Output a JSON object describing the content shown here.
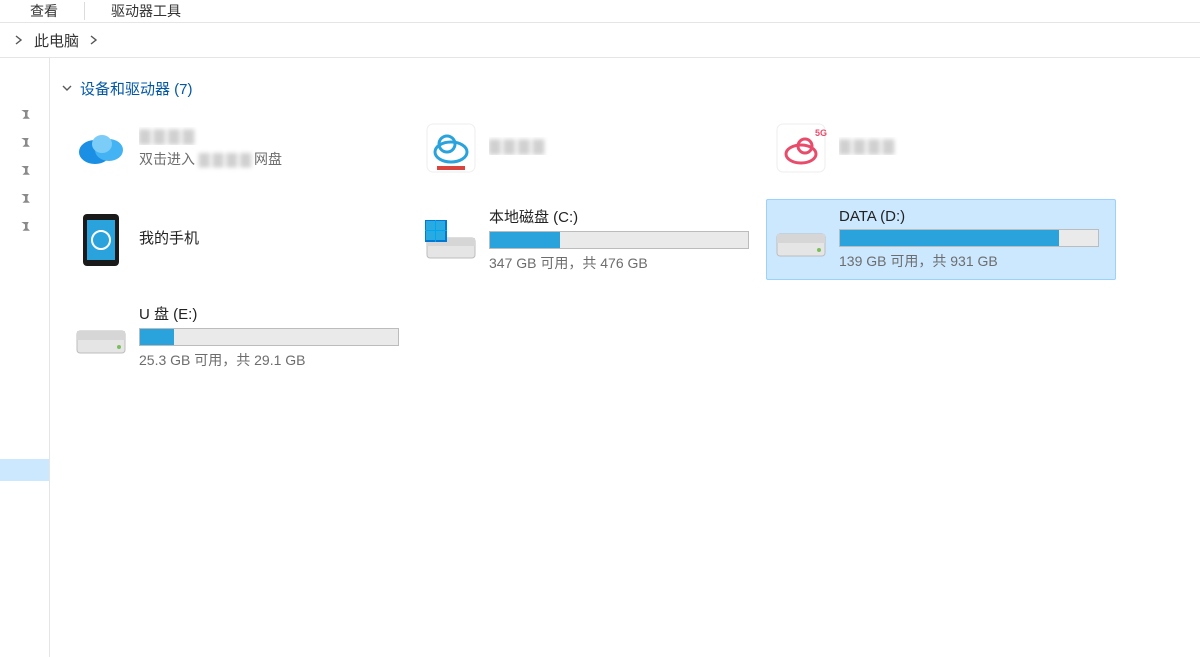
{
  "tabs": {
    "view": "查看",
    "drive_tools": "驱动器工具"
  },
  "breadcrumb": {
    "root": "此电脑"
  },
  "group": {
    "title": "设备和驱动器",
    "count": 7,
    "label_full": "设备和驱动器 (7)"
  },
  "obscured": "▇▇▇▇",
  "items": [
    {
      "kind": "cloud-blue",
      "title": "",
      "sub_prefix": "双击进入",
      "sub_suffix_obscured": true,
      "sub_suffix": "网盘"
    },
    {
      "kind": "cloud-white",
      "title": "",
      "sub": ""
    },
    {
      "kind": "cloud-red",
      "title": "",
      "sub": ""
    },
    {
      "kind": "phone",
      "title": "我的手机",
      "sub": ""
    },
    {
      "kind": "drive-win",
      "title": "本地磁盘 (C:)",
      "sub": "347 GB 可用，共 476 GB",
      "used_pct": 27
    },
    {
      "kind": "drive",
      "title": "DATA (D:)",
      "sub": "139 GB 可用，共 931 GB",
      "used_pct": 85,
      "selected": true
    },
    {
      "kind": "drive",
      "title": "U 盘 (E:)",
      "sub": "25.3 GB 可用，共 29.1 GB",
      "used_pct": 13
    }
  ]
}
